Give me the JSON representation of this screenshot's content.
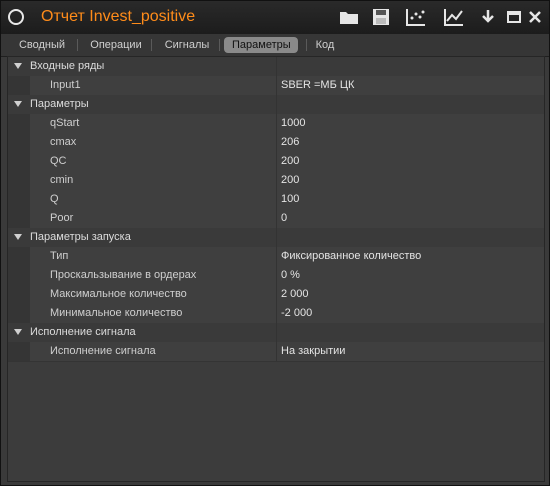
{
  "window": {
    "title": "Отчет Invest_positive"
  },
  "toolbar": {
    "icons": [
      "folder-icon",
      "save-icon",
      "scatter-chart-icon",
      "line-chart-icon",
      "download-icon",
      "minimize-icon",
      "close-icon"
    ]
  },
  "tabs": [
    {
      "label": "Сводный"
    },
    {
      "label": "Операции"
    },
    {
      "label": "Сигналы"
    },
    {
      "label": "Параметры"
    },
    {
      "label": "Код"
    }
  ],
  "active_tab": "Параметры",
  "groups": [
    {
      "label": "Входные ряды",
      "items": [
        {
          "key": "Input1",
          "value": "SBER =МБ ЦК"
        }
      ]
    },
    {
      "label": "Параметры",
      "items": [
        {
          "key": "qStart",
          "value": "1000"
        },
        {
          "key": "cmax",
          "value": "206"
        },
        {
          "key": "QC",
          "value": "200"
        },
        {
          "key": "cmin",
          "value": "200"
        },
        {
          "key": "Q",
          "value": "100"
        },
        {
          "key": "Poor",
          "value": "0"
        }
      ]
    },
    {
      "label": "Параметры запуска",
      "items": [
        {
          "key": "Тип",
          "value": "Фиксированное количество"
        },
        {
          "key": "Проскальзывание в ордерах",
          "value": "0 %"
        },
        {
          "key": "Максимальное количество",
          "value": "2 000"
        },
        {
          "key": "Минимальное количество",
          "value": "-2 000"
        }
      ]
    },
    {
      "label": "Исполнение сигнала",
      "items": [
        {
          "key": "Исполнение сигнала",
          "value": "На закрытии"
        }
      ]
    }
  ],
  "colors": {
    "title": "#ff8c1a",
    "active_tab_bg": "#8a8a8a",
    "background": "#3a3a3a"
  }
}
